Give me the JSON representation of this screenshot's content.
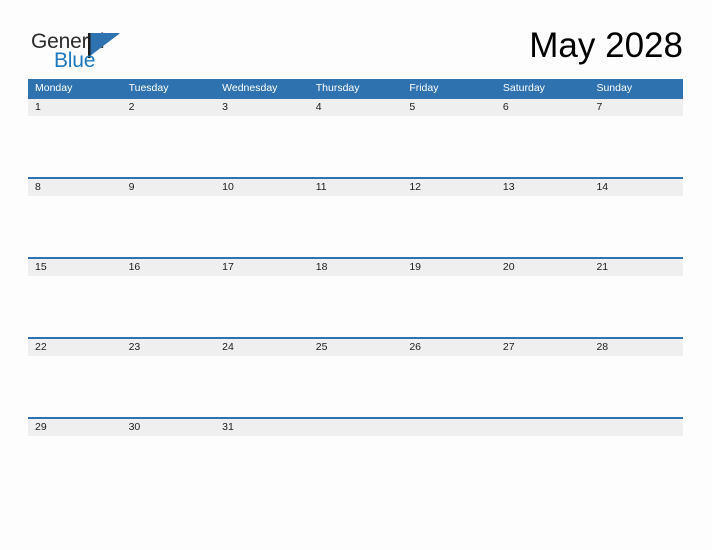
{
  "brand": {
    "name_part1": "General",
    "name_part2": "Blue",
    "flag_color": "#2e72b0",
    "text_color_part1": "#2b2b2b",
    "text_color_part2": "#1f78bd"
  },
  "header": {
    "title": "May 2028",
    "month": "May",
    "year": "2028"
  },
  "theme": {
    "header_blue": "#2e72b0",
    "band_gray": "#efefef",
    "page_background": "#fdfdfd",
    "day_text": "#1c1c1c",
    "weekday_text": "#ffffff"
  },
  "calendar": {
    "weekdays": [
      {
        "label": "Monday"
      },
      {
        "label": "Tuesday"
      },
      {
        "label": "Wednesday"
      },
      {
        "label": "Thursday"
      },
      {
        "label": "Friday"
      },
      {
        "label": "Saturday"
      },
      {
        "label": "Sunday"
      }
    ],
    "weeks": [
      {
        "days": [
          {
            "num": "1"
          },
          {
            "num": "2"
          },
          {
            "num": "3"
          },
          {
            "num": "4"
          },
          {
            "num": "5"
          },
          {
            "num": "6"
          },
          {
            "num": "7"
          }
        ]
      },
      {
        "days": [
          {
            "num": "8"
          },
          {
            "num": "9"
          },
          {
            "num": "10"
          },
          {
            "num": "11"
          },
          {
            "num": "12"
          },
          {
            "num": "13"
          },
          {
            "num": "14"
          }
        ]
      },
      {
        "days": [
          {
            "num": "15"
          },
          {
            "num": "16"
          },
          {
            "num": "17"
          },
          {
            "num": "18"
          },
          {
            "num": "19"
          },
          {
            "num": "20"
          },
          {
            "num": "21"
          }
        ]
      },
      {
        "days": [
          {
            "num": "22"
          },
          {
            "num": "23"
          },
          {
            "num": "24"
          },
          {
            "num": "25"
          },
          {
            "num": "26"
          },
          {
            "num": "27"
          },
          {
            "num": "28"
          }
        ]
      },
      {
        "days": [
          {
            "num": "29"
          },
          {
            "num": "30"
          },
          {
            "num": "31"
          },
          {
            "num": ""
          },
          {
            "num": ""
          },
          {
            "num": ""
          },
          {
            "num": ""
          }
        ]
      }
    ]
  }
}
